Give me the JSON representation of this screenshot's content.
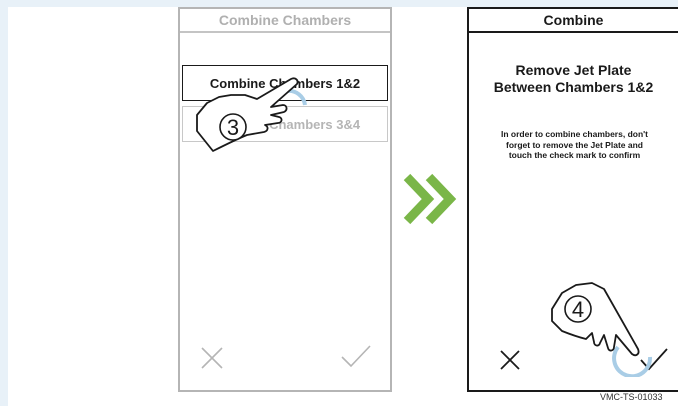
{
  "left_screen": {
    "title": "Combine Chambers",
    "options": [
      {
        "label": "Combine Chambers 1&2",
        "state": "selected"
      },
      {
        "label": "Combine Chambers 3&4",
        "state": "dimmed"
      }
    ],
    "cancel_icon": "close-icon",
    "confirm_icon": "check-icon"
  },
  "right_screen": {
    "title": "Combine",
    "heading": "Remove Jet Plate Between Chambers 1&2",
    "heading_line1": "Remove Jet Plate",
    "heading_line2": "Between Chambers 1&2",
    "message_line1": "In order to combine chambers, don't",
    "message_line2": "forget to remove the Jet Plate and",
    "message_line3": "touch the check mark to confirm",
    "cancel_icon": "close-icon",
    "confirm_icon": "check-icon"
  },
  "steps": [
    {
      "number": "3",
      "icon": "pointing-hand-icon"
    },
    {
      "number": "4",
      "icon": "pointing-hand-icon"
    }
  ],
  "separator_icon": "double-chevron-right-icon",
  "doc_code": "VMC-TS-01033",
  "colors": {
    "accent_green": "#7ab648",
    "touch_ring": "#a9cde6",
    "border_dark": "#1a1a1a",
    "border_grey": "#b5b5b5",
    "background_tint": "#e8f1f8"
  }
}
